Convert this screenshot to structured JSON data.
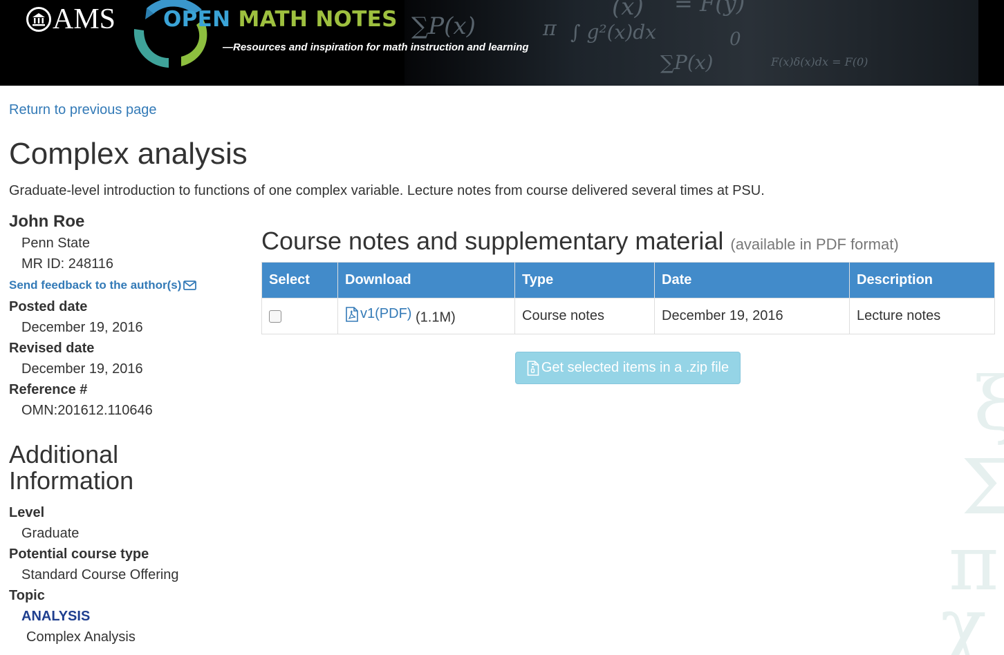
{
  "banner": {
    "org": "AMS",
    "brand_open": "OPEN",
    "brand_math_notes": "MATH NOTES",
    "tagline": "—Resources and inspiration for math instruction and learning"
  },
  "nav": {
    "return_link": "Return to previous page"
  },
  "page": {
    "title": "Complex analysis",
    "description": "Graduate-level introduction to functions of one complex variable. Lecture notes from course delivered several times at PSU."
  },
  "author": {
    "name": "John Roe",
    "affiliation": "Penn State",
    "mr_id": "MR ID: 248116",
    "feedback_link": "Send feedback to the author(s)"
  },
  "meta": {
    "posted_label": "Posted date",
    "posted_value": "December 19, 2016",
    "revised_label": "Revised date",
    "revised_value": "December 19, 2016",
    "reference_label": "Reference #",
    "reference_value": "OMN:201612.110646"
  },
  "additional": {
    "heading": "Additional Information",
    "level_label": "Level",
    "level_value": "Graduate",
    "course_type_label": "Potential course type",
    "course_type_value": "Standard Course Offering",
    "topic_label": "Topic",
    "topic_link": "ANALYSIS",
    "subtopic": "Complex Analysis"
  },
  "course": {
    "heading": "Course notes and supplementary material",
    "heading_note": "(available in PDF format)",
    "columns": [
      "Select",
      "Download",
      "Type",
      "Date",
      "Description"
    ],
    "rows": [
      {
        "selected": false,
        "download_label": "v1(PDF)",
        "size": "(1.1M)",
        "type": "Course notes",
        "date": "December 19, 2016",
        "description": "Lecture notes"
      }
    ],
    "zip_button": "Get selected items in a .zip file"
  },
  "colors": {
    "link": "#337ab7",
    "table_header": "#428bca",
    "zip_button": "#95d4e6",
    "brand_blue": "#3aa3d6",
    "brand_green": "#9ec03f",
    "topic_link": "#1f3f8f"
  },
  "icons": {
    "seal": "ams-seal-icon",
    "logo": "recycle-arrows-logo-icon",
    "feedback": "envelope-icon",
    "pdf": "pdf-file-icon",
    "zip": "zip-file-icon"
  }
}
